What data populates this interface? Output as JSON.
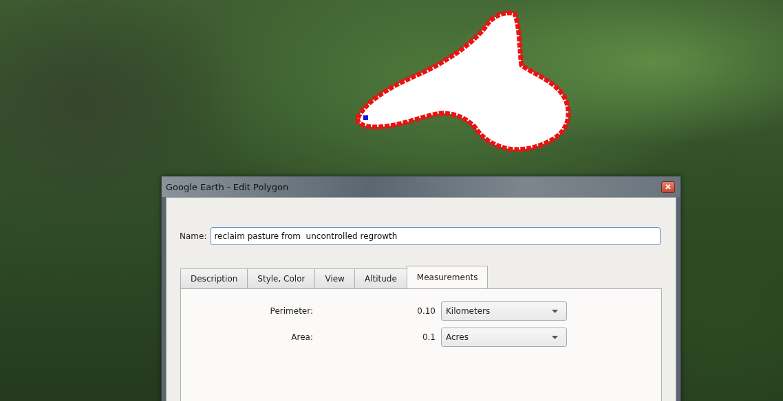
{
  "window": {
    "title": "Google Earth - Edit Polygon"
  },
  "name_field": {
    "label": "Name:",
    "value": "reclaim pasture from  uncontrolled regrowth"
  },
  "tabs": [
    {
      "label": "Description",
      "selected": false
    },
    {
      "label": "Style, Color",
      "selected": false
    },
    {
      "label": "View",
      "selected": false
    },
    {
      "label": "Altitude",
      "selected": false
    },
    {
      "label": "Measurements",
      "selected": true
    }
  ],
  "measurements": [
    {
      "label": "Perimeter:",
      "value": "0.10",
      "unit": "Kilometers"
    },
    {
      "label": "Area:",
      "value": "0.1",
      "unit": "Acres"
    }
  ]
}
